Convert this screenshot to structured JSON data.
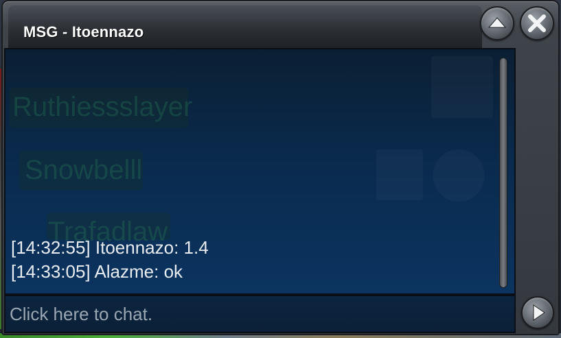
{
  "window": {
    "title": "MSG - Itoennazo"
  },
  "buttons": {
    "minimize_icon": "chevron-up-icon",
    "close_icon": "close-icon",
    "send_icon": "play-arrow-icon"
  },
  "background_names": [
    "Ruthiessslayer",
    "Snowbelll",
    "Trafadlaw"
  ],
  "messages": [
    {
      "text": "[14:32:55] Itoennazo: 1.4"
    },
    {
      "text": "[14:33:05] Alazme: ok"
    }
  ],
  "chat_input": {
    "placeholder": "Click here to chat.",
    "value": ""
  },
  "colors": {
    "panel": "#0a2a4d",
    "text": "#e8ecf0",
    "title_text": "#ffffff"
  }
}
